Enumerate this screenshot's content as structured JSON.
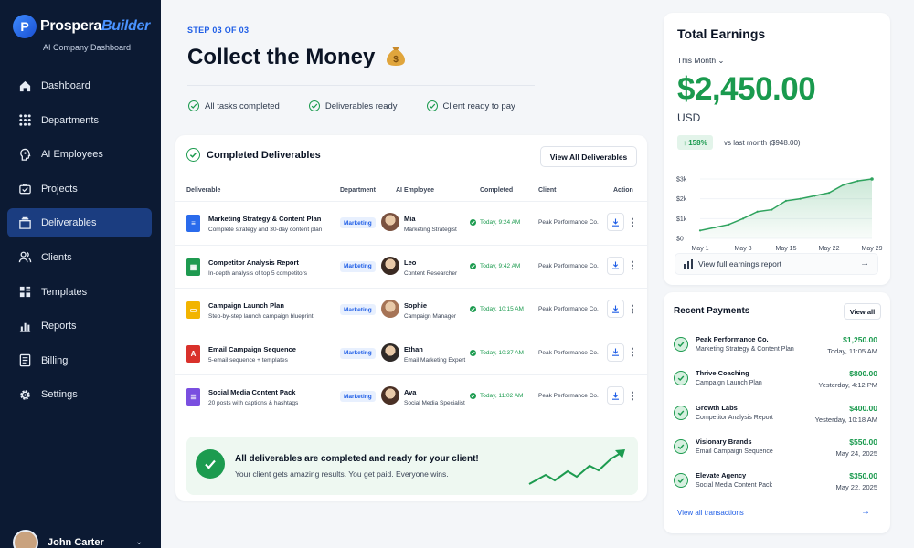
{
  "brand": {
    "name_part1": "Prospera",
    "name_part2": "Builder",
    "subtitle": "AI Company Dashboard",
    "logo_letter": "P"
  },
  "sidebar": {
    "items": [
      {
        "label": "Dashboard",
        "icon": "home-icon"
      },
      {
        "label": "Departments",
        "icon": "grid-icon"
      },
      {
        "label": "AI Employees",
        "icon": "ai-head-icon"
      },
      {
        "label": "Projects",
        "icon": "briefcase-icon"
      },
      {
        "label": "Deliverables",
        "icon": "file-stack-icon",
        "active": true
      },
      {
        "label": "Clients",
        "icon": "users-icon"
      },
      {
        "label": "Templates",
        "icon": "template-icon"
      },
      {
        "label": "Reports",
        "icon": "chart-icon"
      },
      {
        "label": "Billing",
        "icon": "billing-icon"
      },
      {
        "label": "Settings",
        "icon": "gear-icon"
      }
    ],
    "user": {
      "name": "John Carter"
    }
  },
  "header": {
    "step": "STEP 03 OF 03",
    "title": "Collect the Money",
    "checks": [
      "All tasks completed",
      "Deliverables ready",
      "Client ready to pay"
    ]
  },
  "deliverables": {
    "title": "Completed Deliverables",
    "view_all": "View All Deliverables",
    "columns": [
      "Deliverable",
      "Department",
      "AI Employee",
      "Completed",
      "Client",
      "Action"
    ],
    "rows": [
      {
        "name": "Marketing Strategy & Content Plan",
        "desc": "Complete strategy and 30-day content plan",
        "dept": "Marketing",
        "employee": "Mia",
        "role": "Marketing Strategist",
        "completed": "Today, 9:24 AM",
        "client": "Peak Performance Co.",
        "file_color": "#2a6bec",
        "file_glyph": "≡",
        "avatar_color": "#7a5240"
      },
      {
        "name": "Competitor Analysis Report",
        "desc": "In-depth analysis of top 5 competitors",
        "dept": "Marketing",
        "employee": "Leo",
        "role": "Content Researcher",
        "completed": "Today, 9:42 AM",
        "client": "Peak Performance Co.",
        "file_color": "#1e9a50",
        "file_glyph": "▦",
        "avatar_color": "#3a2a22"
      },
      {
        "name": "Campaign Launch Plan",
        "desc": "Step-by-step launch campaign blueprint",
        "dept": "Marketing",
        "employee": "Sophie",
        "role": "Campaign Manager",
        "completed": "Today, 10:15 AM",
        "client": "Peak Performance Co.",
        "file_color": "#f2b400",
        "file_glyph": "▭",
        "avatar_color": "#a67456"
      },
      {
        "name": "Email Campaign Sequence",
        "desc": "5-email sequence + templates",
        "dept": "Marketing",
        "employee": "Ethan",
        "role": "Email Marketing Expert",
        "completed": "Today, 10:37 AM",
        "client": "Peak Performance Co.",
        "file_color": "#d9312b",
        "file_glyph": "A",
        "avatar_color": "#2f2a28"
      },
      {
        "name": "Social Media Content Pack",
        "desc": "20 posts with captions & hashtags",
        "dept": "Marketing",
        "employee": "Ava",
        "role": "Social Media Specialist",
        "completed": "Today, 11:02 AM",
        "client": "Peak Performance Co.",
        "file_color": "#7a4fe0",
        "file_glyph": "≣",
        "avatar_color": "#4a3025"
      }
    ],
    "banner": {
      "title": "All deliverables are completed and ready for your client!",
      "subtitle": "Your client gets amazing results. You get paid. Everyone wins."
    }
  },
  "earnings": {
    "title": "Total Earnings",
    "period": "This Month",
    "amount": "$2,450.00",
    "currency": "USD",
    "change": "158%",
    "vs": "vs last month ($948.00)",
    "link": "View full earnings report"
  },
  "chart_data": {
    "type": "area",
    "x": [
      "May 1",
      "May 3",
      "May 5",
      "May 8",
      "May 11",
      "May 13",
      "May 15",
      "May 18",
      "May 20",
      "May 22",
      "May 25",
      "May 27",
      "May 29"
    ],
    "values": [
      400,
      550,
      700,
      1000,
      1350,
      1450,
      1900,
      2000,
      2150,
      2300,
      2700,
      2900,
      3000
    ],
    "xticks": [
      "May 1",
      "May 8",
      "May 15",
      "May 22",
      "May 29"
    ],
    "yticks": [
      "$0",
      "$1k",
      "$2k",
      "$3k"
    ],
    "ylim": [
      0,
      3000
    ],
    "color": "#2fa35e"
  },
  "payments": {
    "title": "Recent Payments",
    "view_all": "View all",
    "rows": [
      {
        "name": "Peak Performance Co.",
        "desc": "Marketing Strategy & Content Plan",
        "amount": "$1,250.00",
        "date": "Today, 11:05 AM"
      },
      {
        "name": "Thrive Coaching",
        "desc": "Campaign Launch Plan",
        "amount": "$800.00",
        "date": "Yesterday, 4:12 PM"
      },
      {
        "name": "Growth Labs",
        "desc": "Competitor Analysis Report",
        "amount": "$400.00",
        "date": "Yesterday, 10:18 AM"
      },
      {
        "name": "Visionary Brands",
        "desc": "Email Campaign Sequence",
        "amount": "$550.00",
        "date": "May 24, 2025"
      },
      {
        "name": "Elevate Agency",
        "desc": "Social Media Content Pack",
        "amount": "$350.00",
        "date": "May 22, 2025"
      }
    ],
    "link": "View all transactions"
  }
}
